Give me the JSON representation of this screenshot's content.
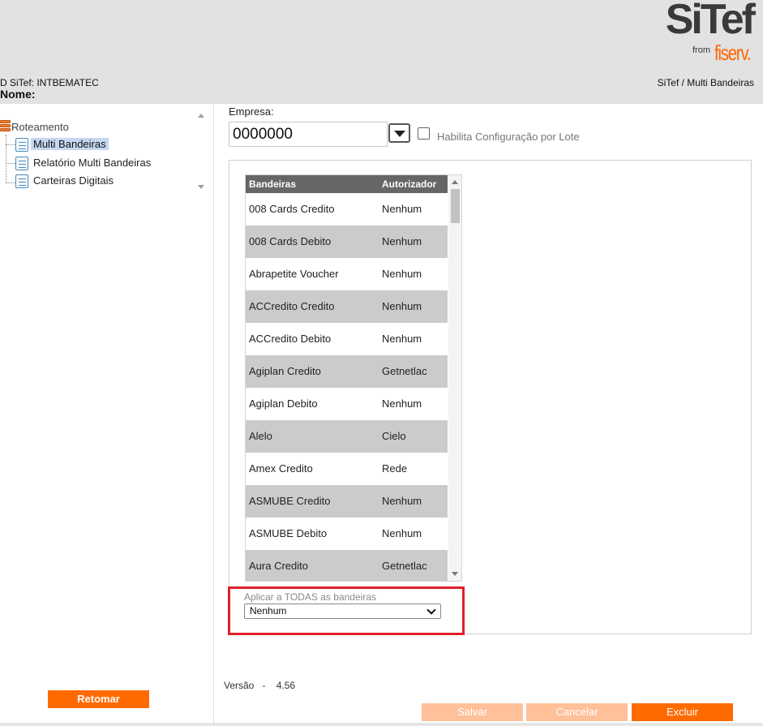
{
  "header": {
    "logo_main": "SiTef",
    "logo_from": "from",
    "logo_brand": "fiserv.",
    "id_text": "D SiTef: INTBEMATEC",
    "nome_label": "Nome:",
    "breadcrumb": "SiTef / Multi Bandeiras"
  },
  "tree": {
    "root": "Roteamento",
    "items": [
      {
        "label": "Multi Bandeiras",
        "selected": true
      },
      {
        "label": "Relatório Multi Bandeiras",
        "selected": false
      },
      {
        "label": "Carteiras Digitais",
        "selected": false
      }
    ]
  },
  "sidebar": {
    "retomar_label": "Retomar"
  },
  "form": {
    "empresa_label": "Empresa:",
    "empresa_value": "0000000",
    "lote_label": "Habilita Configuração por Lote"
  },
  "grid": {
    "headers": [
      "Bandeiras",
      "Autorizador"
    ],
    "rows": [
      [
        "008 Cards Credito",
        "Nenhum"
      ],
      [
        "008 Cards Debito",
        "Nenhum"
      ],
      [
        "Abrapetite Voucher",
        "Nenhum"
      ],
      [
        "ACCredito Credito",
        "Nenhum"
      ],
      [
        "ACCredito Debito",
        "Nenhum"
      ],
      [
        "Agiplan Credito",
        "Getnetlac"
      ],
      [
        "Agiplan Debito",
        "Nenhum"
      ],
      [
        "Alelo",
        "Cielo"
      ],
      [
        "Amex Credito",
        "Rede"
      ],
      [
        "ASMUBE Credito",
        "Nenhum"
      ],
      [
        "ASMUBE Debito",
        "Nenhum"
      ],
      [
        "Aura Credito",
        "Getnetlac"
      ]
    ]
  },
  "aplicar": {
    "label": "Aplicar a TODAS as bandeiras",
    "selected": "Nenhum"
  },
  "footer": {
    "versao_label": "Versão",
    "versao_sep": "-",
    "versao_value": "4.56",
    "salvar_label": "Salvar",
    "cancelar_label": "Cancelar",
    "excluir_label": "Excluir"
  },
  "colors": {
    "accent": "#ff6a00",
    "accent_disabled": "#ffc09a",
    "highlight": "#e0202a",
    "header_bg": "#e2e2e2",
    "grid_header": "#666666",
    "row_alt": "#cbcbcb"
  }
}
